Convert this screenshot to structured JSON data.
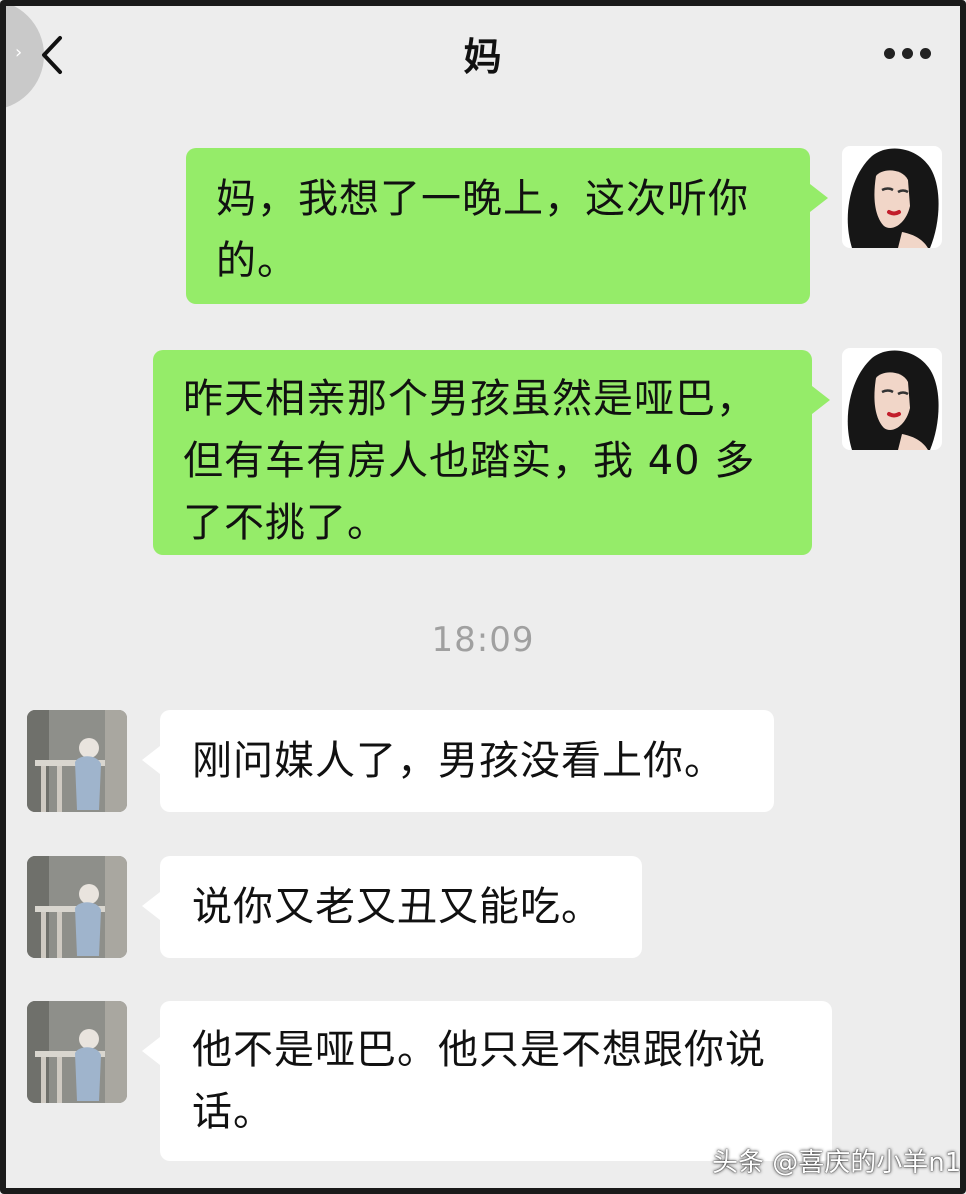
{
  "header": {
    "title": "妈",
    "back_icon": "chevron-left-icon",
    "more_icon": "more-dots-icon"
  },
  "messages": [
    {
      "from": "me",
      "text": "妈，我想了一晚上，这次听你的。"
    },
    {
      "from": "me",
      "text": "昨天相亲那个男孩虽然是哑巴，但有车有房人也踏实，我 40 多了不挑了。"
    },
    {
      "from": "them",
      "text": "刚问媒人了，男孩没看上你。"
    },
    {
      "from": "them",
      "text": "说你又老又丑又能吃。"
    },
    {
      "from": "them",
      "text": "他不是哑巴。他只是不想跟你说话。"
    }
  ],
  "timestamp": "18:09",
  "watermark": "头条 @喜庆的小羊n1",
  "colors": {
    "background": "#ededed",
    "my_bubble": "#95ec69",
    "their_bubble": "#ffffff",
    "timestamp": "#a0a0a0"
  }
}
